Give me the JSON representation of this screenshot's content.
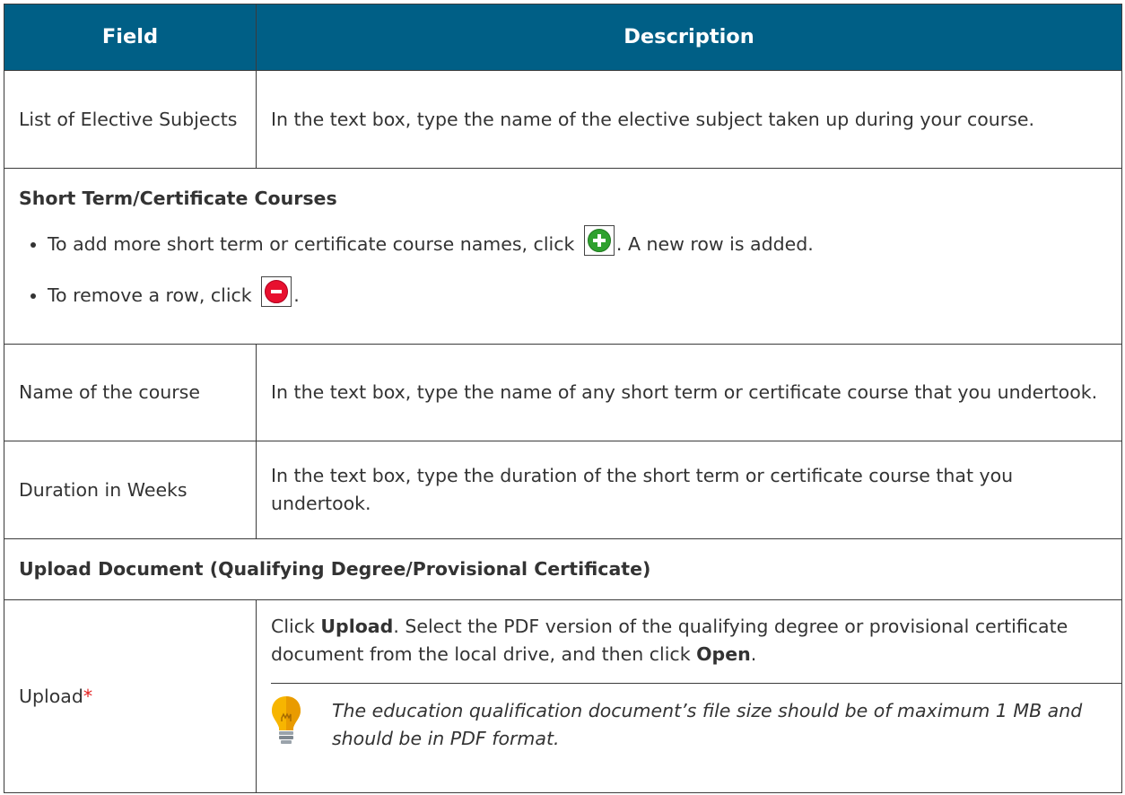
{
  "header": {
    "field_label": "Field",
    "description_label": "Description"
  },
  "rows": {
    "elective": {
      "field": "List of Elective Subjects",
      "description": "In the text box, type the name of the elective subject taken up during your course."
    },
    "short_term_section": {
      "title": "Short Term/Certificate Courses",
      "bullet_add_before": "To add more short term or certificate course names, click",
      "bullet_add_after": ". A new row is added.",
      "bullet_remove_before": "To remove a row, click",
      "bullet_remove_after": "."
    },
    "course_name": {
      "field": "Name of the course",
      "description": "In the text box, type the name of any short term or certificate course that you undertook."
    },
    "duration": {
      "field": "Duration in Weeks",
      "description": "In the text box, type the duration of the short term or certificate course that you undertook."
    },
    "upload_section": {
      "title": "Upload Document (Qualifying Degree/Provisional Certificate)"
    },
    "upload": {
      "field": "Upload",
      "required_mark": "*",
      "desc_part1": "Click ",
      "desc_upload": "Upload",
      "desc_part2": ". Select the PDF version of the qualifying degree or provisional certificate document from the local drive, and then click ",
      "desc_open": "Open",
      "desc_part3": ".",
      "tip": "The education qualification document’s file size should be of maximum 1 MB and should be in PDF format."
    }
  },
  "icons": {
    "add": "plus-circle-icon",
    "remove": "minus-circle-icon",
    "tip": "lightbulb-icon"
  },
  "colors": {
    "header_bg": "#005f86",
    "add_icon": "#2ea12e",
    "remove_icon": "#e8102f",
    "required": "#e32020",
    "lightbulb": "#f7b500"
  }
}
